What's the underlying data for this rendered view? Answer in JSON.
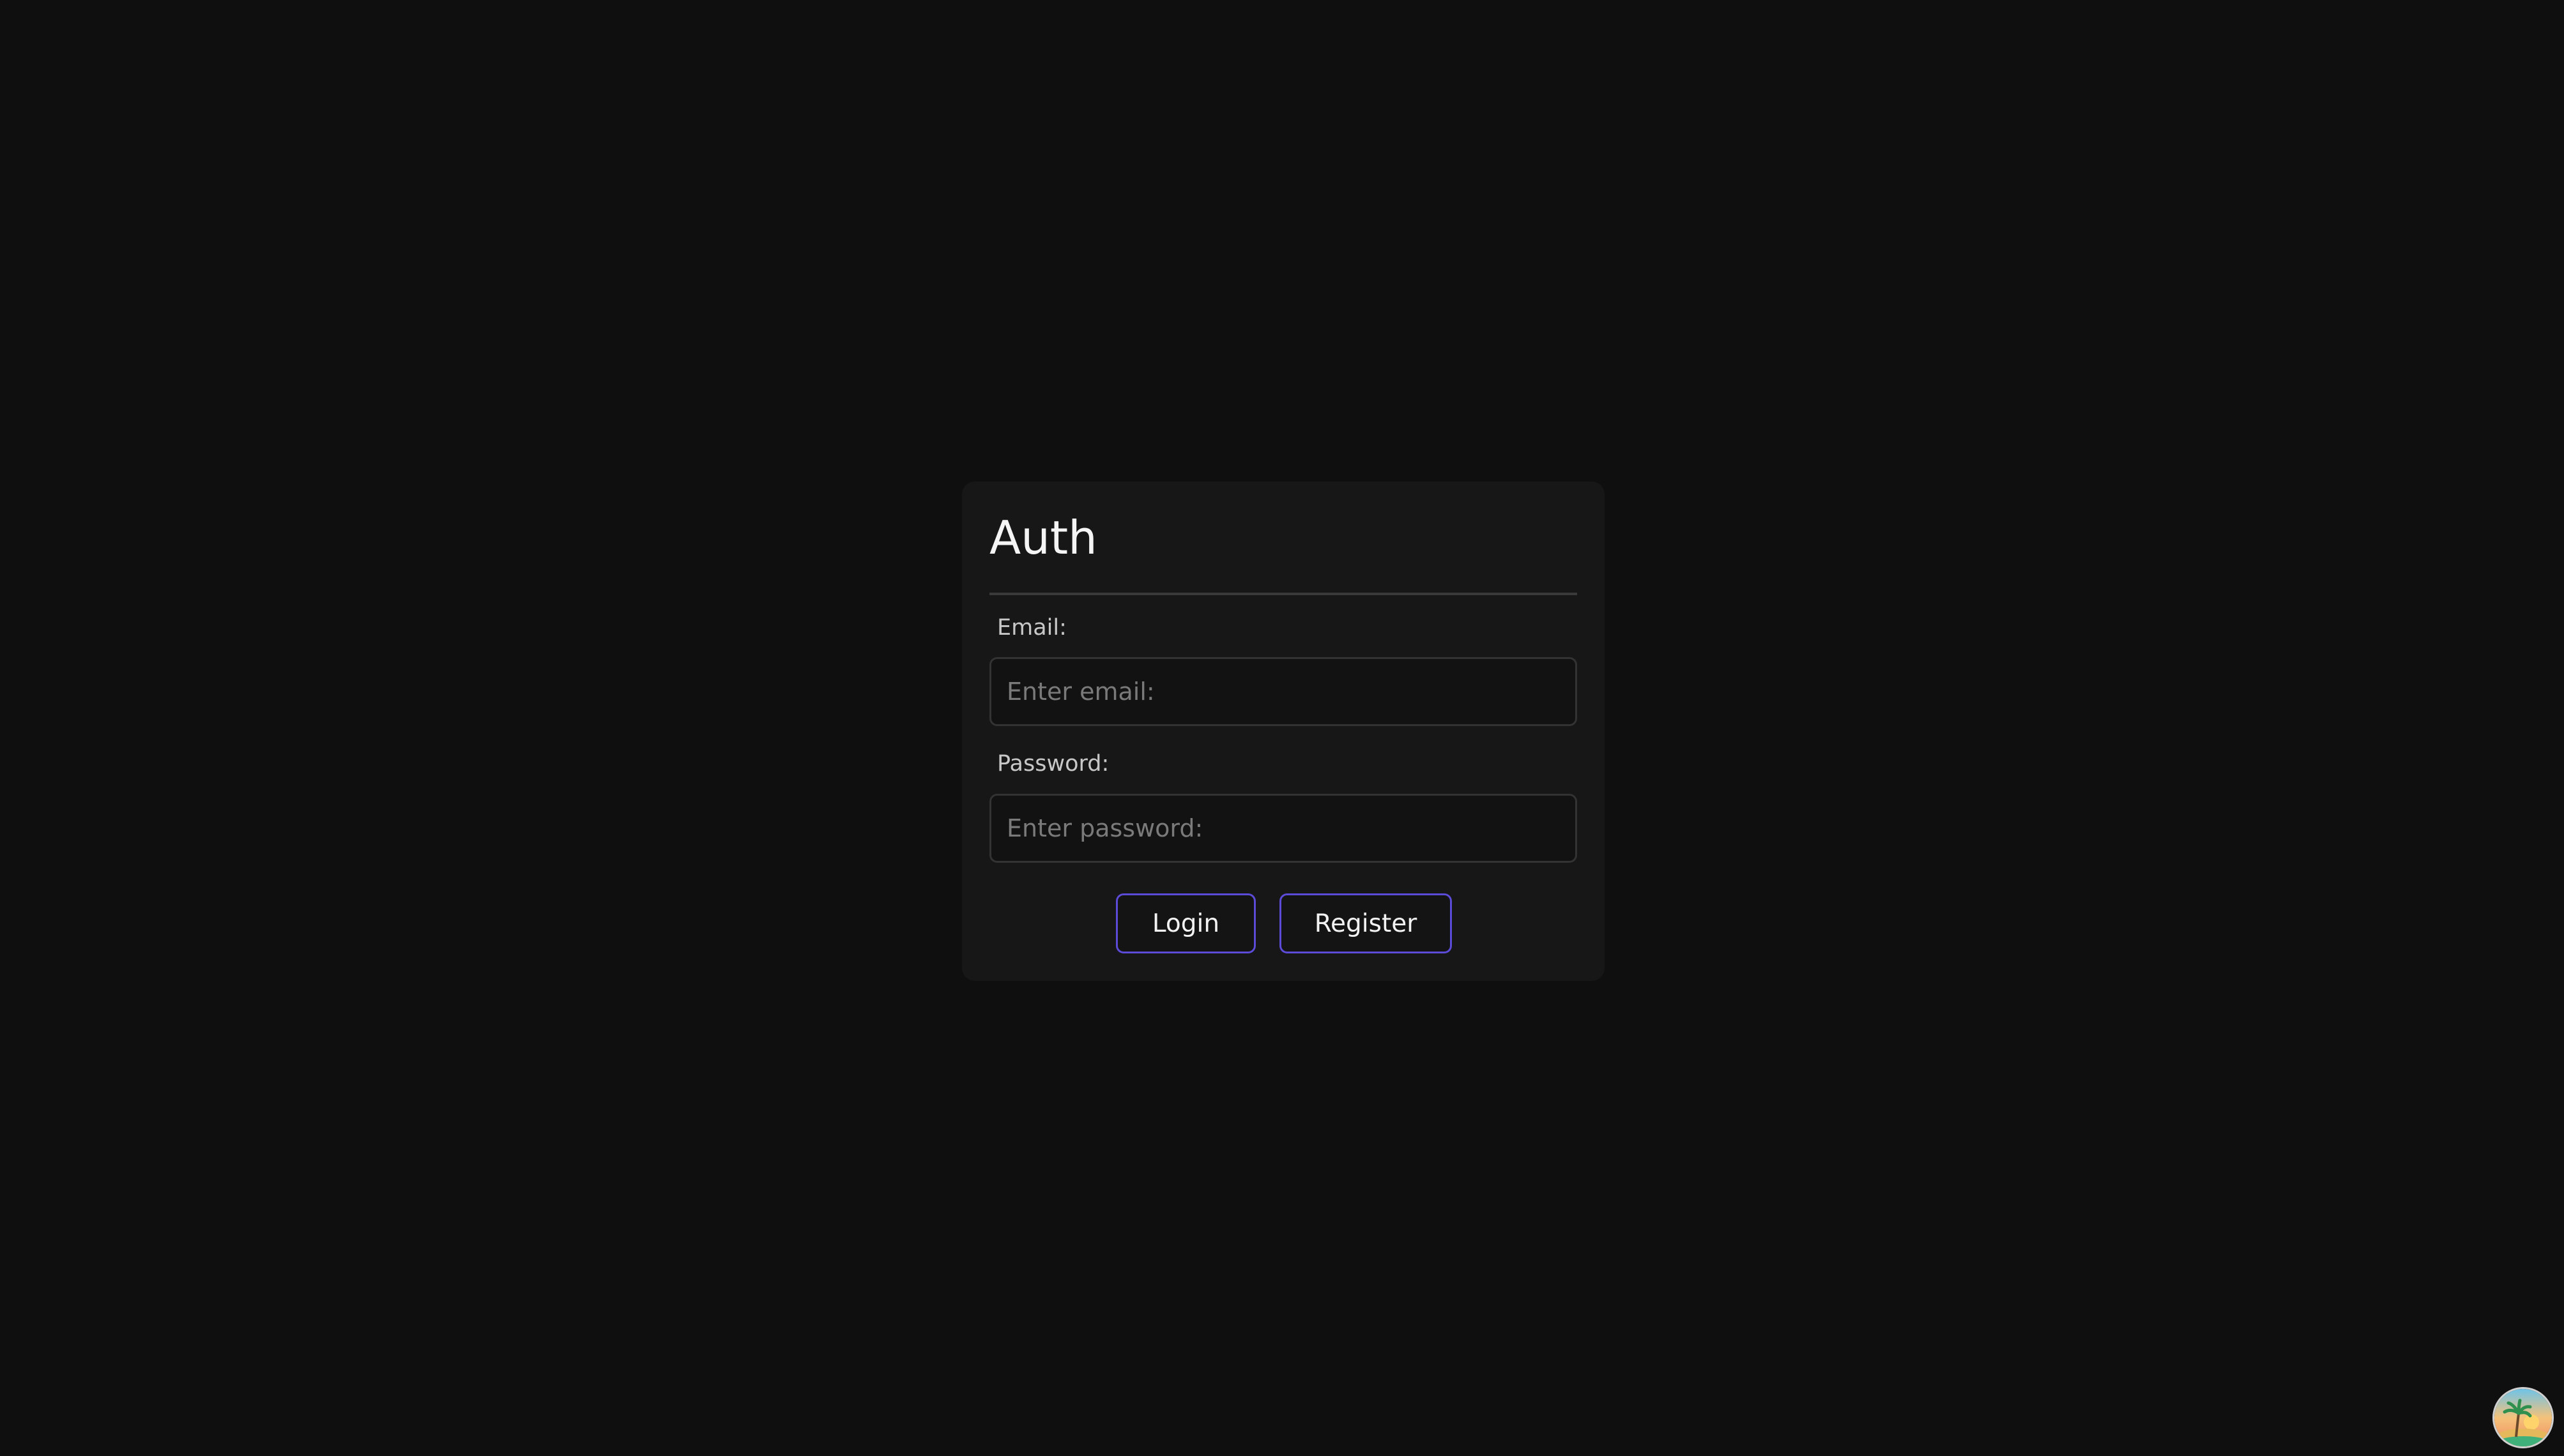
{
  "auth": {
    "title": "Auth",
    "email_label": "Email:",
    "email_placeholder": "Enter email:",
    "email_value": "",
    "password_label": "Password:",
    "password_placeholder": "Enter password:",
    "password_value": "",
    "login_label": "Login",
    "register_label": "Register"
  },
  "colors": {
    "background": "#0f0f0f",
    "card": "#171717",
    "button_border": "#5b4bd6"
  },
  "corner": {
    "icon": "palm-beach-sunset-avatar-icon"
  }
}
